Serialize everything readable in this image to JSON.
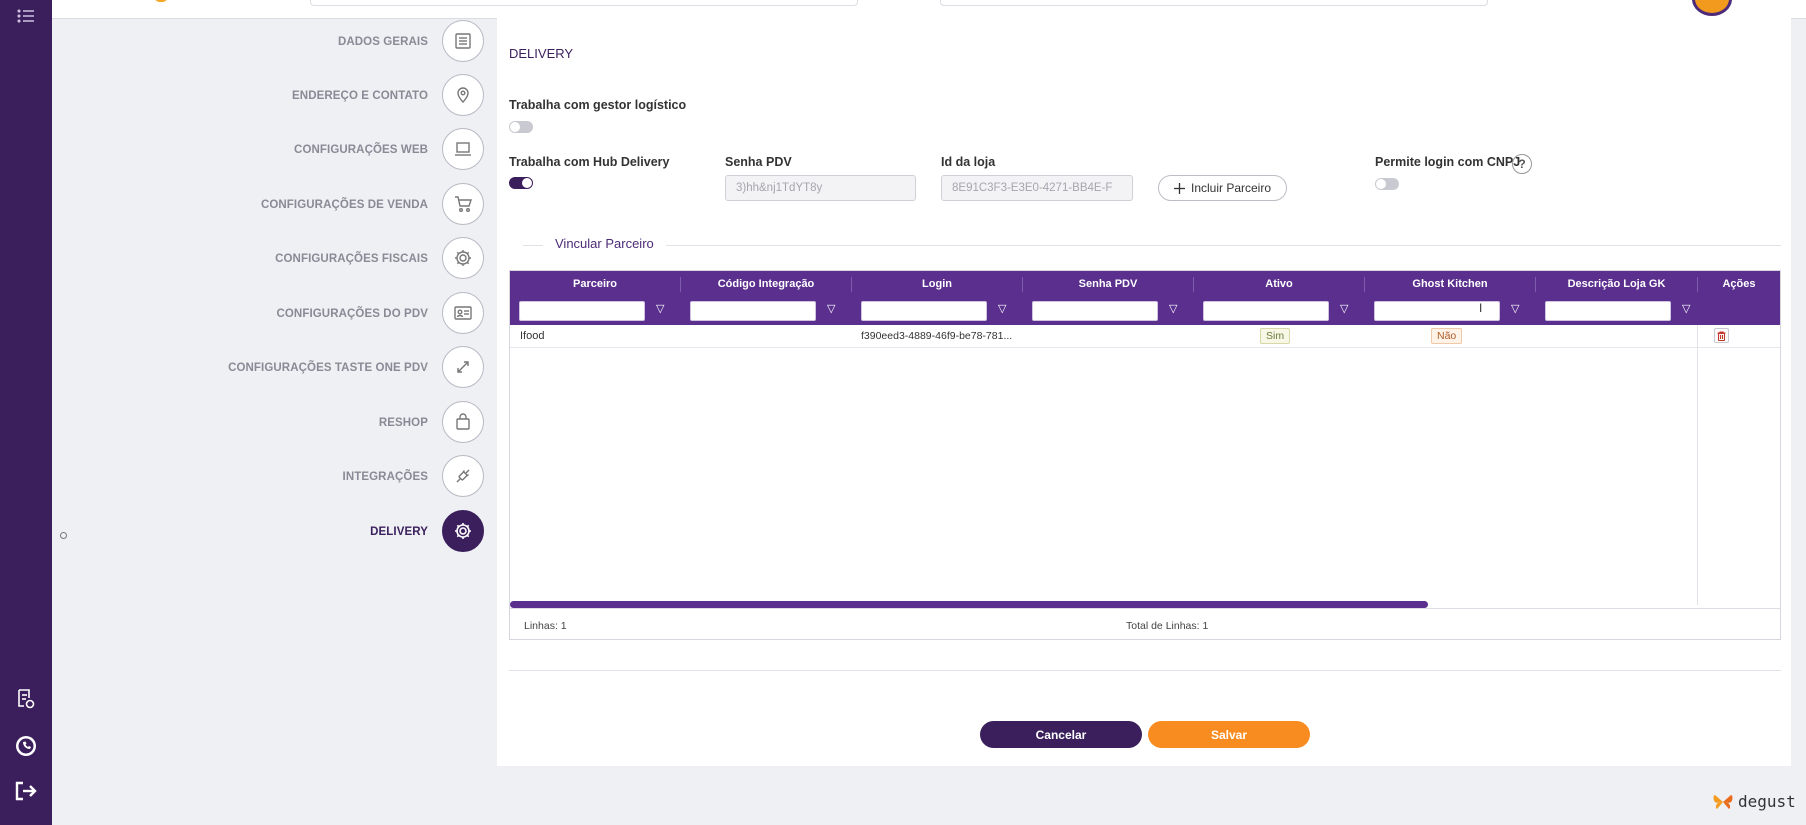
{
  "nav": {
    "items": [
      {
        "label": "DADOS GERAIS",
        "icon": "list-icon"
      },
      {
        "label": "ENDEREÇO E CONTATO",
        "icon": "location-pin-icon"
      },
      {
        "label": "CONFIGURAÇÕES WEB",
        "icon": "laptop-icon"
      },
      {
        "label": "CONFIGURAÇÕES DE VENDA",
        "icon": "cart-icon"
      },
      {
        "label": "CONFIGURAÇÕES FISCAIS",
        "icon": "gear-icon"
      },
      {
        "label": "CONFIGURAÇÕES DO PDV",
        "icon": "id-card-icon"
      },
      {
        "label": "CONFIGURAÇÕES TASTE ONE PDV",
        "icon": "expand-arrows-icon"
      },
      {
        "label": "RESHOP",
        "icon": "shopping-bag-icon"
      },
      {
        "label": "INTEGRAÇÕES",
        "icon": "plug-icon"
      },
      {
        "label": "DELIVERY",
        "icon": "gear-icon"
      }
    ],
    "active": "DELIVERY"
  },
  "delivery": {
    "title": "DELIVERY",
    "gestor_label": "Trabalha com gestor logístico",
    "gestor_on": false,
    "hub_label": "Trabalha com Hub Delivery",
    "hub_on": true,
    "senha_label": "Senha PDV",
    "senha_value": "3)hh&nj1TdYT8y",
    "loja_label": "Id da loja",
    "loja_value": "8E91C3F3-E3E0-4271-BB4E-F",
    "incluir_label": "Incluir Parceiro",
    "cnpj_label": "Permite login com CNPJ",
    "cnpj_on": false,
    "help_glyph": "?"
  },
  "vincular": {
    "legend": "Vincular Parceiro",
    "columns": [
      "Parceiro",
      "Código Integração",
      "Login",
      "Senha PDV",
      "Ativo",
      "Ghost Kitchen",
      "Descrição Loja GK",
      "Ações"
    ],
    "rows": [
      {
        "parceiro": "Ifood",
        "codigo": "",
        "login": "f390eed3-4889-46f9-be78-781...",
        "senha": "",
        "ativo": "Sim",
        "ghost": "Não",
        "descricao": ""
      }
    ],
    "linhas": "Linhas: 1",
    "total": "Total de Linhas: 1"
  },
  "footer": {
    "cancel_label": "Cancelar",
    "save_label": "Salvar"
  },
  "brand": {
    "name": "degust"
  },
  "colors": {
    "primary": "#3a1f5c",
    "header": "#5a2f8e",
    "accent": "#f98c20"
  }
}
